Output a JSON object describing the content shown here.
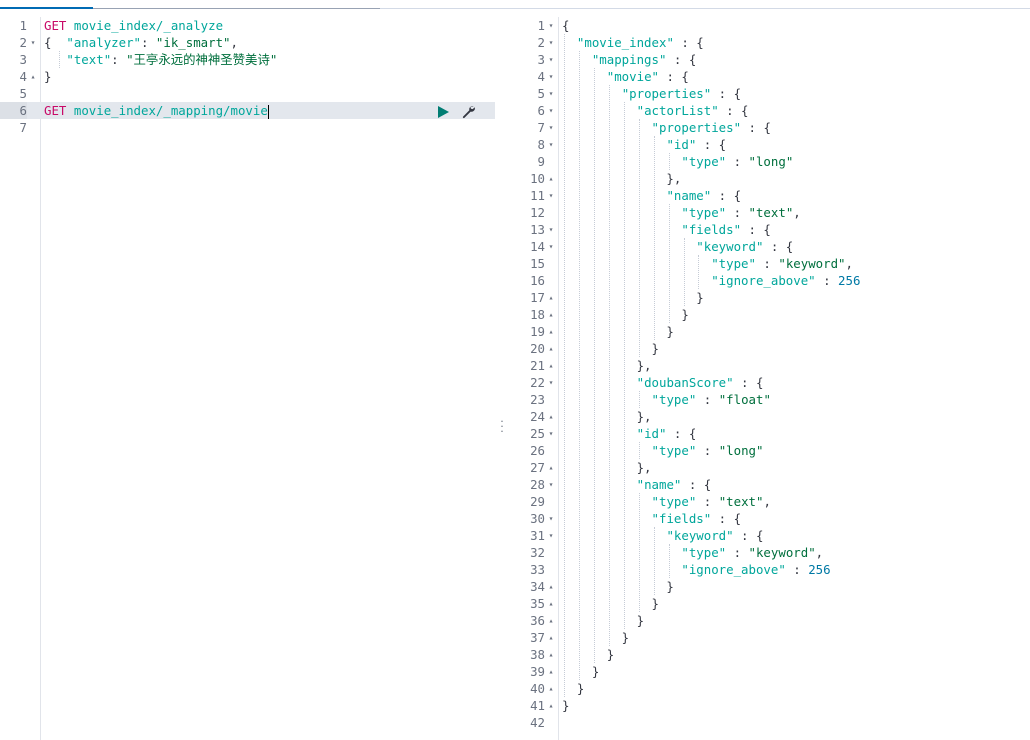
{
  "request_editor": {
    "lines": [
      {
        "no": "1",
        "fold": "",
        "tokens": [
          {
            "t": "m",
            "v": "GET"
          },
          {
            "t": "p",
            "v": " "
          },
          {
            "t": "u",
            "v": "movie_index/_analyze"
          }
        ]
      },
      {
        "no": "2",
        "fold": "▾",
        "tokens": [
          {
            "t": "p",
            "v": "{  "
          },
          {
            "t": "k",
            "v": "\"analyzer\""
          },
          {
            "t": "p",
            "v": ": "
          },
          {
            "t": "s",
            "v": "\"ik_smart\""
          },
          {
            "t": "p",
            "v": ","
          }
        ]
      },
      {
        "no": "3",
        "fold": "",
        "tokens": [
          {
            "t": "p",
            "v": "   "
          },
          {
            "t": "k",
            "v": "\"text\""
          },
          {
            "t": "p",
            "v": ": "
          },
          {
            "t": "s",
            "v": "\"王亭永远的神神圣赞美诗\""
          }
        ]
      },
      {
        "no": "4",
        "fold": "▴",
        "tokens": [
          {
            "t": "p",
            "v": "}"
          }
        ]
      },
      {
        "no": "5",
        "fold": "",
        "tokens": []
      },
      {
        "no": "6",
        "fold": "",
        "active": true,
        "tokens": [
          {
            "t": "m",
            "v": "GET"
          },
          {
            "t": "p",
            "v": " "
          },
          {
            "t": "u",
            "v": "movie_index/_mapping/movie"
          }
        ]
      },
      {
        "no": "7",
        "fold": "",
        "tokens": []
      }
    ],
    "run_icon": "play-icon",
    "settings_icon": "wrench-icon"
  },
  "response_viewer": {
    "lines": [
      {
        "no": "1",
        "fold": "▾",
        "tokens": [
          {
            "t": "p",
            "v": "{"
          }
        ]
      },
      {
        "no": "2",
        "fold": "▾",
        "tokens": [
          {
            "t": "p",
            "v": "  "
          },
          {
            "t": "k",
            "v": "\"movie_index\""
          },
          {
            "t": "p",
            "v": " : {"
          }
        ]
      },
      {
        "no": "3",
        "fold": "▾",
        "tokens": [
          {
            "t": "p",
            "v": "    "
          },
          {
            "t": "k",
            "v": "\"mappings\""
          },
          {
            "t": "p",
            "v": " : {"
          }
        ]
      },
      {
        "no": "4",
        "fold": "▾",
        "tokens": [
          {
            "t": "p",
            "v": "      "
          },
          {
            "t": "k",
            "v": "\"movie\""
          },
          {
            "t": "p",
            "v": " : {"
          }
        ]
      },
      {
        "no": "5",
        "fold": "▾",
        "tokens": [
          {
            "t": "p",
            "v": "        "
          },
          {
            "t": "k",
            "v": "\"properties\""
          },
          {
            "t": "p",
            "v": " : {"
          }
        ]
      },
      {
        "no": "6",
        "fold": "▾",
        "tokens": [
          {
            "t": "p",
            "v": "          "
          },
          {
            "t": "k",
            "v": "\"actorList\""
          },
          {
            "t": "p",
            "v": " : {"
          }
        ]
      },
      {
        "no": "7",
        "fold": "▾",
        "tokens": [
          {
            "t": "p",
            "v": "            "
          },
          {
            "t": "k",
            "v": "\"properties\""
          },
          {
            "t": "p",
            "v": " : {"
          }
        ]
      },
      {
        "no": "8",
        "fold": "▾",
        "tokens": [
          {
            "t": "p",
            "v": "              "
          },
          {
            "t": "k",
            "v": "\"id\""
          },
          {
            "t": "p",
            "v": " : {"
          }
        ]
      },
      {
        "no": "9",
        "fold": "",
        "tokens": [
          {
            "t": "p",
            "v": "                "
          },
          {
            "t": "k",
            "v": "\"type\""
          },
          {
            "t": "p",
            "v": " : "
          },
          {
            "t": "s",
            "v": "\"long\""
          }
        ]
      },
      {
        "no": "10",
        "fold": "▴",
        "tokens": [
          {
            "t": "p",
            "v": "              },"
          }
        ]
      },
      {
        "no": "11",
        "fold": "▾",
        "tokens": [
          {
            "t": "p",
            "v": "              "
          },
          {
            "t": "k",
            "v": "\"name\""
          },
          {
            "t": "p",
            "v": " : {"
          }
        ]
      },
      {
        "no": "12",
        "fold": "",
        "tokens": [
          {
            "t": "p",
            "v": "                "
          },
          {
            "t": "k",
            "v": "\"type\""
          },
          {
            "t": "p",
            "v": " : "
          },
          {
            "t": "s",
            "v": "\"text\""
          },
          {
            "t": "p",
            "v": ","
          }
        ]
      },
      {
        "no": "13",
        "fold": "▾",
        "tokens": [
          {
            "t": "p",
            "v": "                "
          },
          {
            "t": "k",
            "v": "\"fields\""
          },
          {
            "t": "p",
            "v": " : {"
          }
        ]
      },
      {
        "no": "14",
        "fold": "▾",
        "tokens": [
          {
            "t": "p",
            "v": "                  "
          },
          {
            "t": "k",
            "v": "\"keyword\""
          },
          {
            "t": "p",
            "v": " : {"
          }
        ]
      },
      {
        "no": "15",
        "fold": "",
        "tokens": [
          {
            "t": "p",
            "v": "                    "
          },
          {
            "t": "k",
            "v": "\"type\""
          },
          {
            "t": "p",
            "v": " : "
          },
          {
            "t": "s",
            "v": "\"keyword\""
          },
          {
            "t": "p",
            "v": ","
          }
        ]
      },
      {
        "no": "16",
        "fold": "",
        "tokens": [
          {
            "t": "p",
            "v": "                    "
          },
          {
            "t": "k",
            "v": "\"ignore_above\""
          },
          {
            "t": "p",
            "v": " : "
          },
          {
            "t": "n",
            "v": "256"
          }
        ]
      },
      {
        "no": "17",
        "fold": "▴",
        "tokens": [
          {
            "t": "p",
            "v": "                  }"
          }
        ]
      },
      {
        "no": "18",
        "fold": "▴",
        "tokens": [
          {
            "t": "p",
            "v": "                }"
          }
        ]
      },
      {
        "no": "19",
        "fold": "▴",
        "tokens": [
          {
            "t": "p",
            "v": "              }"
          }
        ]
      },
      {
        "no": "20",
        "fold": "▴",
        "tokens": [
          {
            "t": "p",
            "v": "            }"
          }
        ]
      },
      {
        "no": "21",
        "fold": "▴",
        "tokens": [
          {
            "t": "p",
            "v": "          },"
          }
        ]
      },
      {
        "no": "22",
        "fold": "▾",
        "tokens": [
          {
            "t": "p",
            "v": "          "
          },
          {
            "t": "k",
            "v": "\"doubanScore\""
          },
          {
            "t": "p",
            "v": " : {"
          }
        ]
      },
      {
        "no": "23",
        "fold": "",
        "tokens": [
          {
            "t": "p",
            "v": "            "
          },
          {
            "t": "k",
            "v": "\"type\""
          },
          {
            "t": "p",
            "v": " : "
          },
          {
            "t": "s",
            "v": "\"float\""
          }
        ]
      },
      {
        "no": "24",
        "fold": "▴",
        "tokens": [
          {
            "t": "p",
            "v": "          },"
          }
        ]
      },
      {
        "no": "25",
        "fold": "▾",
        "tokens": [
          {
            "t": "p",
            "v": "          "
          },
          {
            "t": "k",
            "v": "\"id\""
          },
          {
            "t": "p",
            "v": " : {"
          }
        ]
      },
      {
        "no": "26",
        "fold": "",
        "tokens": [
          {
            "t": "p",
            "v": "            "
          },
          {
            "t": "k",
            "v": "\"type\""
          },
          {
            "t": "p",
            "v": " : "
          },
          {
            "t": "s",
            "v": "\"long\""
          }
        ]
      },
      {
        "no": "27",
        "fold": "▴",
        "tokens": [
          {
            "t": "p",
            "v": "          },"
          }
        ]
      },
      {
        "no": "28",
        "fold": "▾",
        "tokens": [
          {
            "t": "p",
            "v": "          "
          },
          {
            "t": "k",
            "v": "\"name\""
          },
          {
            "t": "p",
            "v": " : {"
          }
        ]
      },
      {
        "no": "29",
        "fold": "",
        "tokens": [
          {
            "t": "p",
            "v": "            "
          },
          {
            "t": "k",
            "v": "\"type\""
          },
          {
            "t": "p",
            "v": " : "
          },
          {
            "t": "s",
            "v": "\"text\""
          },
          {
            "t": "p",
            "v": ","
          }
        ]
      },
      {
        "no": "30",
        "fold": "▾",
        "tokens": [
          {
            "t": "p",
            "v": "            "
          },
          {
            "t": "k",
            "v": "\"fields\""
          },
          {
            "t": "p",
            "v": " : {"
          }
        ]
      },
      {
        "no": "31",
        "fold": "▾",
        "tokens": [
          {
            "t": "p",
            "v": "              "
          },
          {
            "t": "k",
            "v": "\"keyword\""
          },
          {
            "t": "p",
            "v": " : {"
          }
        ]
      },
      {
        "no": "32",
        "fold": "",
        "tokens": [
          {
            "t": "p",
            "v": "                "
          },
          {
            "t": "k",
            "v": "\"type\""
          },
          {
            "t": "p",
            "v": " : "
          },
          {
            "t": "s",
            "v": "\"keyword\""
          },
          {
            "t": "p",
            "v": ","
          }
        ]
      },
      {
        "no": "33",
        "fold": "",
        "tokens": [
          {
            "t": "p",
            "v": "                "
          },
          {
            "t": "k",
            "v": "\"ignore_above\""
          },
          {
            "t": "p",
            "v": " : "
          },
          {
            "t": "n",
            "v": "256"
          }
        ]
      },
      {
        "no": "34",
        "fold": "▴",
        "tokens": [
          {
            "t": "p",
            "v": "              }"
          }
        ]
      },
      {
        "no": "35",
        "fold": "▴",
        "tokens": [
          {
            "t": "p",
            "v": "            }"
          }
        ]
      },
      {
        "no": "36",
        "fold": "▴",
        "tokens": [
          {
            "t": "p",
            "v": "          }"
          }
        ]
      },
      {
        "no": "37",
        "fold": "▴",
        "tokens": [
          {
            "t": "p",
            "v": "        }"
          }
        ]
      },
      {
        "no": "38",
        "fold": "▴",
        "tokens": [
          {
            "t": "p",
            "v": "      }"
          }
        ]
      },
      {
        "no": "39",
        "fold": "▴",
        "tokens": [
          {
            "t": "p",
            "v": "    }"
          }
        ]
      },
      {
        "no": "40",
        "fold": "▴",
        "tokens": [
          {
            "t": "p",
            "v": "  }"
          }
        ]
      },
      {
        "no": "41",
        "fold": "▴",
        "tokens": [
          {
            "t": "p",
            "v": "}"
          }
        ]
      },
      {
        "no": "42",
        "fold": "",
        "tokens": []
      }
    ]
  },
  "divider": {
    "icon": "drag-handle-icon"
  },
  "colors": {
    "method": "#c80a68",
    "url": "#00a69b",
    "key": "#00a69b",
    "string": "#006f3d",
    "number": "#0079a5",
    "active_line": "#e3e7ed",
    "run_button": "#017d73"
  }
}
